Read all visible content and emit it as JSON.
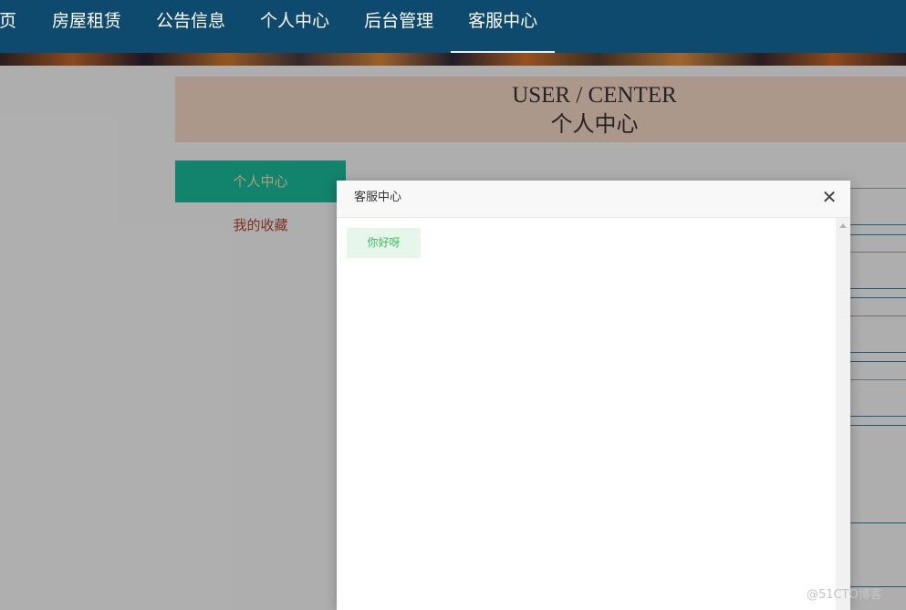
{
  "nav": {
    "items": [
      {
        "label": "页"
      },
      {
        "label": "房屋租赁"
      },
      {
        "label": "公告信息"
      },
      {
        "label": "个人中心"
      },
      {
        "label": "后台管理"
      },
      {
        "label": "客服中心"
      }
    ]
  },
  "header": {
    "title_en": "USER / CENTER",
    "title_cn": "个人中心"
  },
  "sidebar": {
    "items": [
      {
        "label": "个人中心"
      },
      {
        "label": "我的收藏"
      }
    ]
  },
  "dialog": {
    "title": "客服中心",
    "close_symbol": "✕",
    "messages": [
      {
        "text": "你好呀"
      }
    ]
  },
  "watermark": "@51CTO博客",
  "colors": {
    "nav_bg": "#0e4a6e",
    "sidebar_active": "#1bbc9b",
    "header_bg": "#f7d9c8",
    "bubble_bg": "#e6f6ea",
    "bubble_text": "#3bbf58"
  }
}
